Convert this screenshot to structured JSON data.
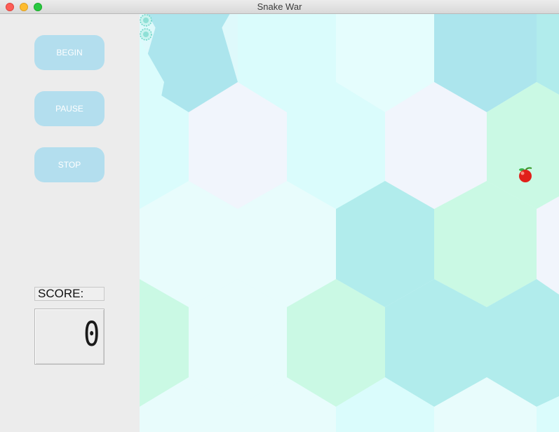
{
  "window": {
    "title": "Snake War"
  },
  "controls": {
    "begin_label": "BEGIN",
    "pause_label": "PAUSE",
    "stop_label": "STOP"
  },
  "score": {
    "label": "SCORE:",
    "value": "0"
  },
  "board": {
    "background_tiles": [
      "#ace5ed",
      "#dafcfc",
      "#e5fdfd",
      "#f1f5fc",
      "#caf9e4",
      "#b1ecec",
      "#e8fcfc"
    ],
    "items": [
      {
        "type": "apple",
        "icon": "apple-icon"
      },
      {
        "type": "snake",
        "segments": 2,
        "icon": "snake-segment-icon"
      }
    ]
  },
  "colors": {
    "button_bg": "#b3deee",
    "button_text": "#ffffff",
    "sidebar_bg": "#ececec"
  }
}
